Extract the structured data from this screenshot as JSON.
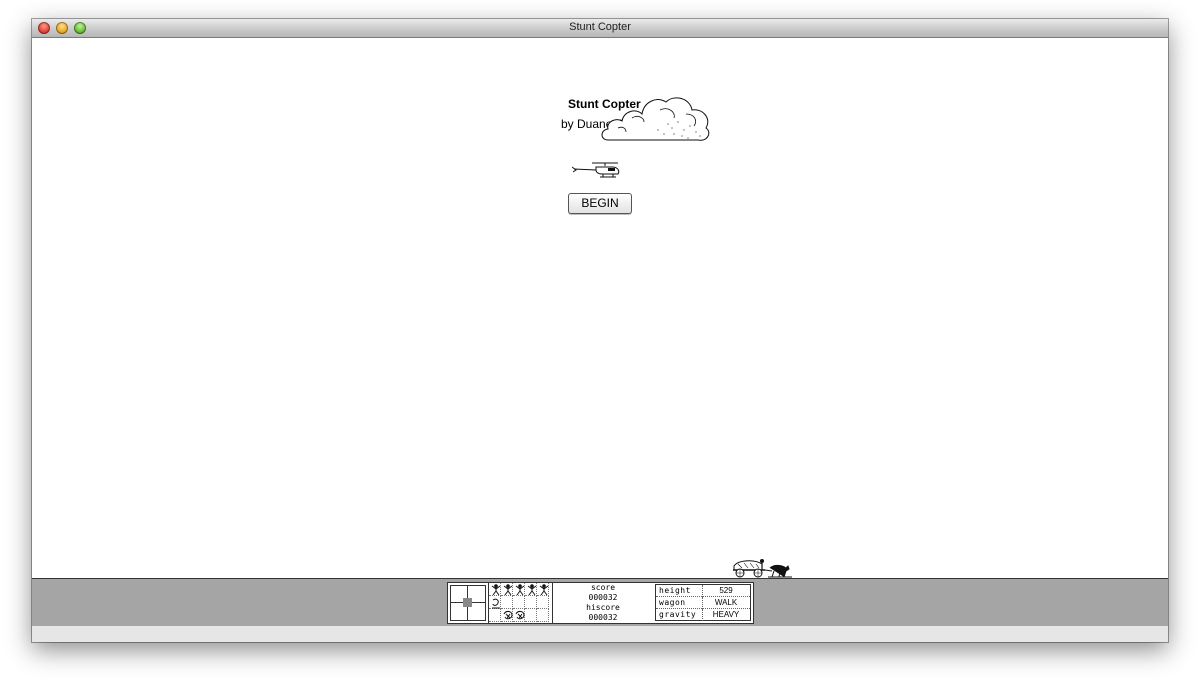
{
  "window": {
    "title": "Stunt Copter"
  },
  "game": {
    "title": "Stunt Copter",
    "author": "by Duane Blehm",
    "begin_label": "BEGIN"
  },
  "status": {
    "score_label": "score",
    "score_value": "000032",
    "hiscore_label": "hiscore",
    "hiscore_value": "000032",
    "stats": [
      {
        "label": "height",
        "value": "529"
      },
      {
        "label": "wagon",
        "value": "WALK"
      },
      {
        "label": "gravity",
        "value": "HEAVY"
      }
    ],
    "stunt_icons": [
      "stunt-man-icon",
      "stunt-man-icon",
      "stunt-man-icon",
      "stunt-man-icon",
      "stunt-man-icon",
      "splash-icon",
      "crash-icon",
      "crash-icon"
    ]
  },
  "colors": {
    "status_bar": "#a5a5a5",
    "bottom_strip": "#e6e6e6"
  }
}
